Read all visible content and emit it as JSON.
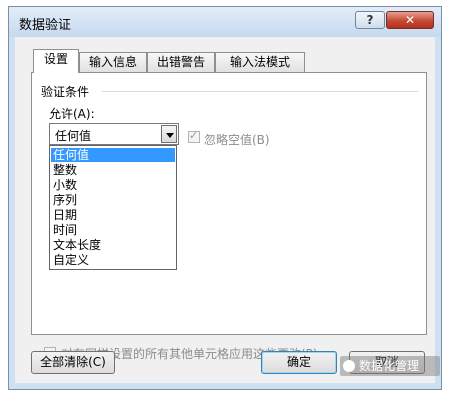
{
  "window": {
    "title": "数据验证",
    "help_glyph": "?",
    "close_glyph": "✕"
  },
  "tabs": [
    {
      "label": "设置",
      "active": true
    },
    {
      "label": "输入信息",
      "active": false
    },
    {
      "label": "出错警告",
      "active": false
    },
    {
      "label": "输入法模式",
      "active": false
    }
  ],
  "settings": {
    "group_label": "验证条件",
    "allow_label": "允许(A):",
    "allow_value": "任何值",
    "ignore_blank_label": "忽略空值(B)",
    "ignore_blank_checked": true,
    "options": [
      "任何值",
      "整数",
      "小数",
      "序列",
      "日期",
      "时间",
      "文本长度",
      "自定义"
    ],
    "selected_option": "任何值",
    "apply_all_label": "对有同样设置的所有其他单元格应用这些更改(P)",
    "apply_all_checked": false
  },
  "footer": {
    "clear_all_label": "全部清除(C)",
    "ok_label": "确定",
    "cancel_label": "取消"
  },
  "watermark": {
    "text": "数据化管理"
  }
}
